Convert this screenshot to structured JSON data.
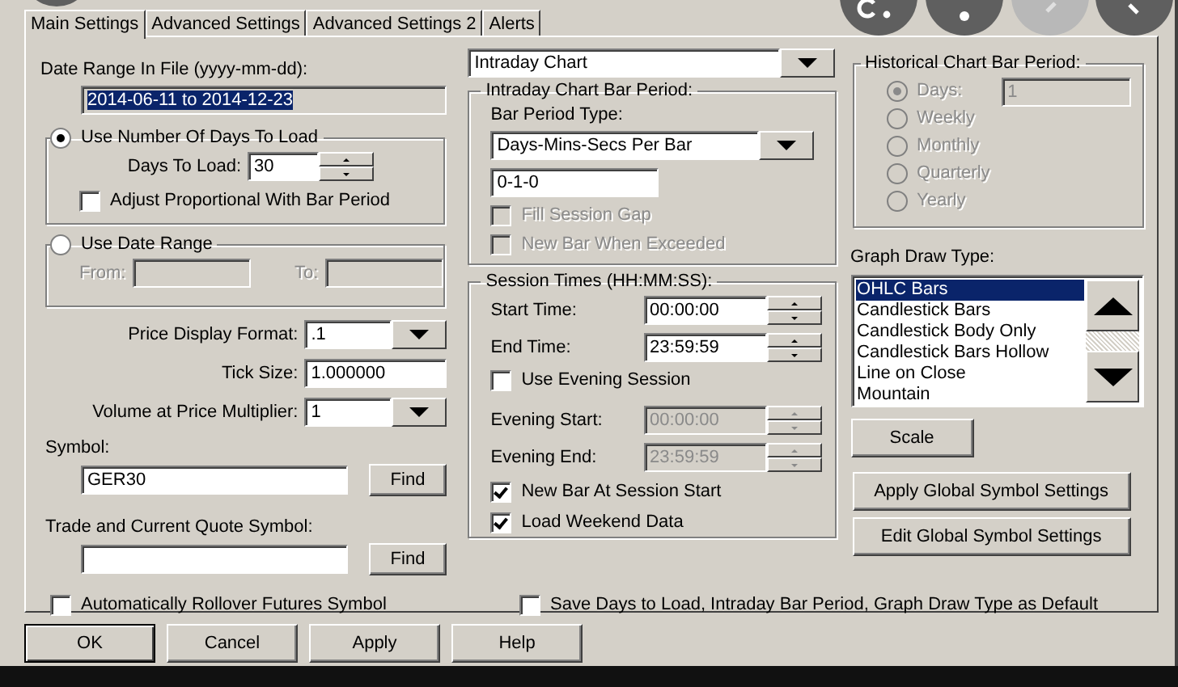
{
  "tabs": [
    {
      "label": "Main Settings",
      "selected": true
    },
    {
      "label": "Advanced Settings",
      "selected": false
    },
    {
      "label": "Advanced Settings 2",
      "selected": false
    },
    {
      "label": "Alerts",
      "selected": false
    }
  ],
  "date_range": {
    "label": "Date Range In File (yyyy-mm-dd):",
    "value": "2014-06-11 to 2014-12-23"
  },
  "days_group": {
    "label": "Use Number Of Days To Load",
    "selected": true,
    "days_label": "Days To Load:",
    "days_value": "30",
    "adjust": {
      "label": "Adjust Proportional With Bar Period",
      "checked": false
    }
  },
  "date_group": {
    "label": "Use Date Range",
    "selected": false,
    "from_label": "From:",
    "to_label": "To:",
    "disabled": true
  },
  "price_format": {
    "label": "Price Display Format:",
    "value": ".1"
  },
  "tick_size": {
    "label": "Tick Size:",
    "value": "1.000000"
  },
  "volume_multiplier": {
    "label": "Volume at Price Multiplier:",
    "value": "1"
  },
  "symbol": {
    "label": "Symbol:",
    "value": "GER30",
    "button": "Find"
  },
  "trade_symbol": {
    "label": "Trade and Current Quote Symbol:",
    "button": "Find"
  },
  "auto_rollover": {
    "label": "Automatically Rollover Futures Symbol",
    "checked": false
  },
  "chart_type": {
    "value": "Intraday Chart"
  },
  "intraday_period": {
    "title": "Intraday Chart Bar Period:",
    "type_label": "Bar Period Type:",
    "type_value": "Days-Mins-Secs Per Bar",
    "period_value": "0-1-0",
    "options": [
      {
        "label": "Fill Session Gap",
        "checked": false,
        "disabled": true
      },
      {
        "label": "New Bar When Exceeded",
        "checked": false,
        "disabled": true
      }
    ]
  },
  "session": {
    "title": "Session Times (HH:MM:SS):",
    "times": [
      {
        "label": "Start Time:",
        "value": "00:00:00",
        "disabled": false
      },
      {
        "label": "End Time:",
        "value": "23:59:59",
        "disabled": false
      }
    ],
    "evening": {
      "label": "Use Evening Session",
      "checked": false
    },
    "evening_times": [
      {
        "label": "Evening Start:",
        "value": "00:00:00",
        "disabled": true
      },
      {
        "label": "Evening End:",
        "value": "23:59:59",
        "disabled": true
      }
    ],
    "options": [
      {
        "label": "New Bar At Session Start",
        "checked": true
      },
      {
        "label": "Load Weekend Data",
        "checked": true
      }
    ]
  },
  "save_default": {
    "label": "Save Days to Load, Intraday Bar Period, Graph Draw Type as Default",
    "checked": false
  },
  "historical": {
    "title": "Historical Chart Bar Period:",
    "disabled": true,
    "days_value": "1",
    "options": [
      {
        "label": "Days:",
        "selected": true
      },
      {
        "label": "Weekly",
        "selected": false
      },
      {
        "label": "Monthly",
        "selected": false
      },
      {
        "label": "Quarterly",
        "selected": false
      },
      {
        "label": "Yearly",
        "selected": false
      }
    ]
  },
  "graph_draw": {
    "label": "Graph Draw Type:",
    "items": [
      {
        "label": "OHLC Bars",
        "selected": true
      },
      {
        "label": "Candlestick Bars",
        "selected": false
      },
      {
        "label": "Candlestick Body Only",
        "selected": false
      },
      {
        "label": "Candlestick Bars Hollow",
        "selected": false
      },
      {
        "label": "Line on Close",
        "selected": false
      },
      {
        "label": "Mountain",
        "selected": false
      }
    ]
  },
  "side_buttons": [
    "Scale",
    "Apply Global Symbol Settings",
    "Edit Global Symbol Settings"
  ],
  "buttons": [
    "OK",
    "Cancel",
    "Apply",
    "Help"
  ]
}
